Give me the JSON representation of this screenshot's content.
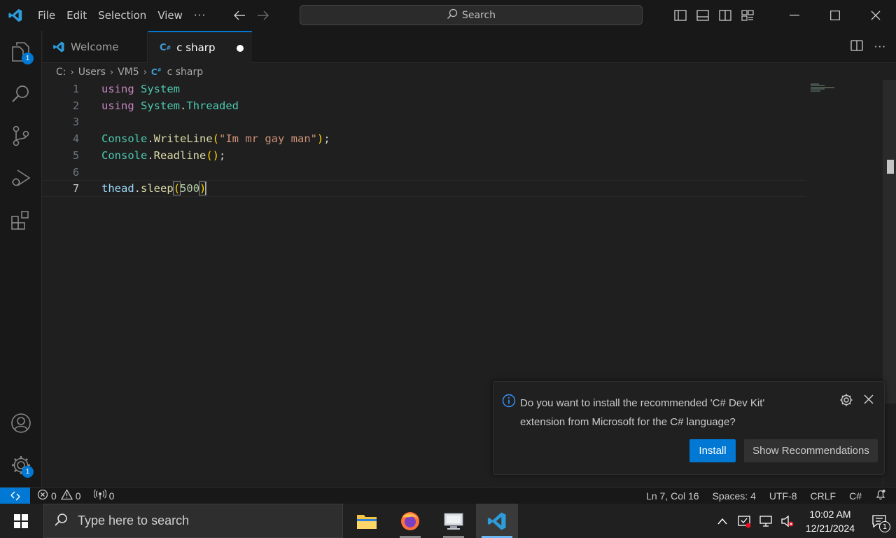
{
  "menu": {
    "items": [
      "File",
      "Edit",
      "Selection",
      "View",
      "···"
    ]
  },
  "search": {
    "label": "Search"
  },
  "tabs": [
    {
      "label": "Welcome",
      "icon": "vscode-icon"
    },
    {
      "label": "c sharp",
      "icon": "csharp-icon",
      "dirty": true
    }
  ],
  "breadcrumb": [
    "C:",
    "Users",
    "VM5",
    "c sharp"
  ],
  "activity": {
    "explorer_badge": "1",
    "manage_badge": "1"
  },
  "editor": {
    "lines": [
      {
        "num": "1",
        "tokens": [
          [
            "kw",
            "using"
          ],
          [
            "pn",
            " "
          ],
          [
            "ty",
            "System"
          ]
        ]
      },
      {
        "num": "2",
        "tokens": [
          [
            "kw",
            "using"
          ],
          [
            "pn",
            " "
          ],
          [
            "ty",
            "System"
          ],
          [
            "pn",
            "."
          ],
          [
            "ty",
            "Threaded"
          ]
        ]
      },
      {
        "num": "3",
        "tokens": []
      },
      {
        "num": "4",
        "tokens": [
          [
            "ty",
            "Console"
          ],
          [
            "pn",
            "."
          ],
          [
            "fn",
            "WriteLine"
          ],
          [
            "br",
            "("
          ],
          [
            "str",
            "\"Im mr gay man\""
          ],
          [
            "br",
            ")"
          ],
          [
            "pn",
            ";"
          ]
        ]
      },
      {
        "num": "5",
        "tokens": [
          [
            "ty",
            "Console"
          ],
          [
            "pn",
            "."
          ],
          [
            "fn",
            "Readline"
          ],
          [
            "br",
            "()"
          ],
          [
            "pn",
            ";"
          ]
        ]
      },
      {
        "num": "6",
        "tokens": []
      },
      {
        "num": "7",
        "tokens": [
          [
            "id",
            "thead"
          ],
          [
            "pn",
            "."
          ],
          [
            "fn",
            "sleep"
          ],
          [
            "br",
            "("
          ],
          [
            "num",
            "500"
          ],
          [
            "br",
            ")"
          ]
        ]
      }
    ],
    "current_line": "7"
  },
  "notification": {
    "message_line1": "Do you want to install the recommended 'C# Dev Kit'",
    "message_line2": "extension from Microsoft for the C# language?",
    "install_label": "Install",
    "recommendations_label": "Show Recommendations"
  },
  "status": {
    "errors": "0",
    "warnings": "0",
    "ports": "0",
    "position": "Ln 7, Col 16",
    "spaces": "Spaces: 4",
    "encoding": "UTF-8",
    "eol": "CRLF",
    "language": "C#"
  },
  "taskbar": {
    "search_placeholder": "Type here to search",
    "time": "10:02 AM",
    "date": "12/21/2024",
    "notification_count": "1"
  },
  "colors": {
    "accent": "#0078d4",
    "keyword": "#c586c0",
    "type": "#4ec9b0",
    "function": "#dcdcaa",
    "string": "#ce9178",
    "number": "#b5cea8"
  }
}
